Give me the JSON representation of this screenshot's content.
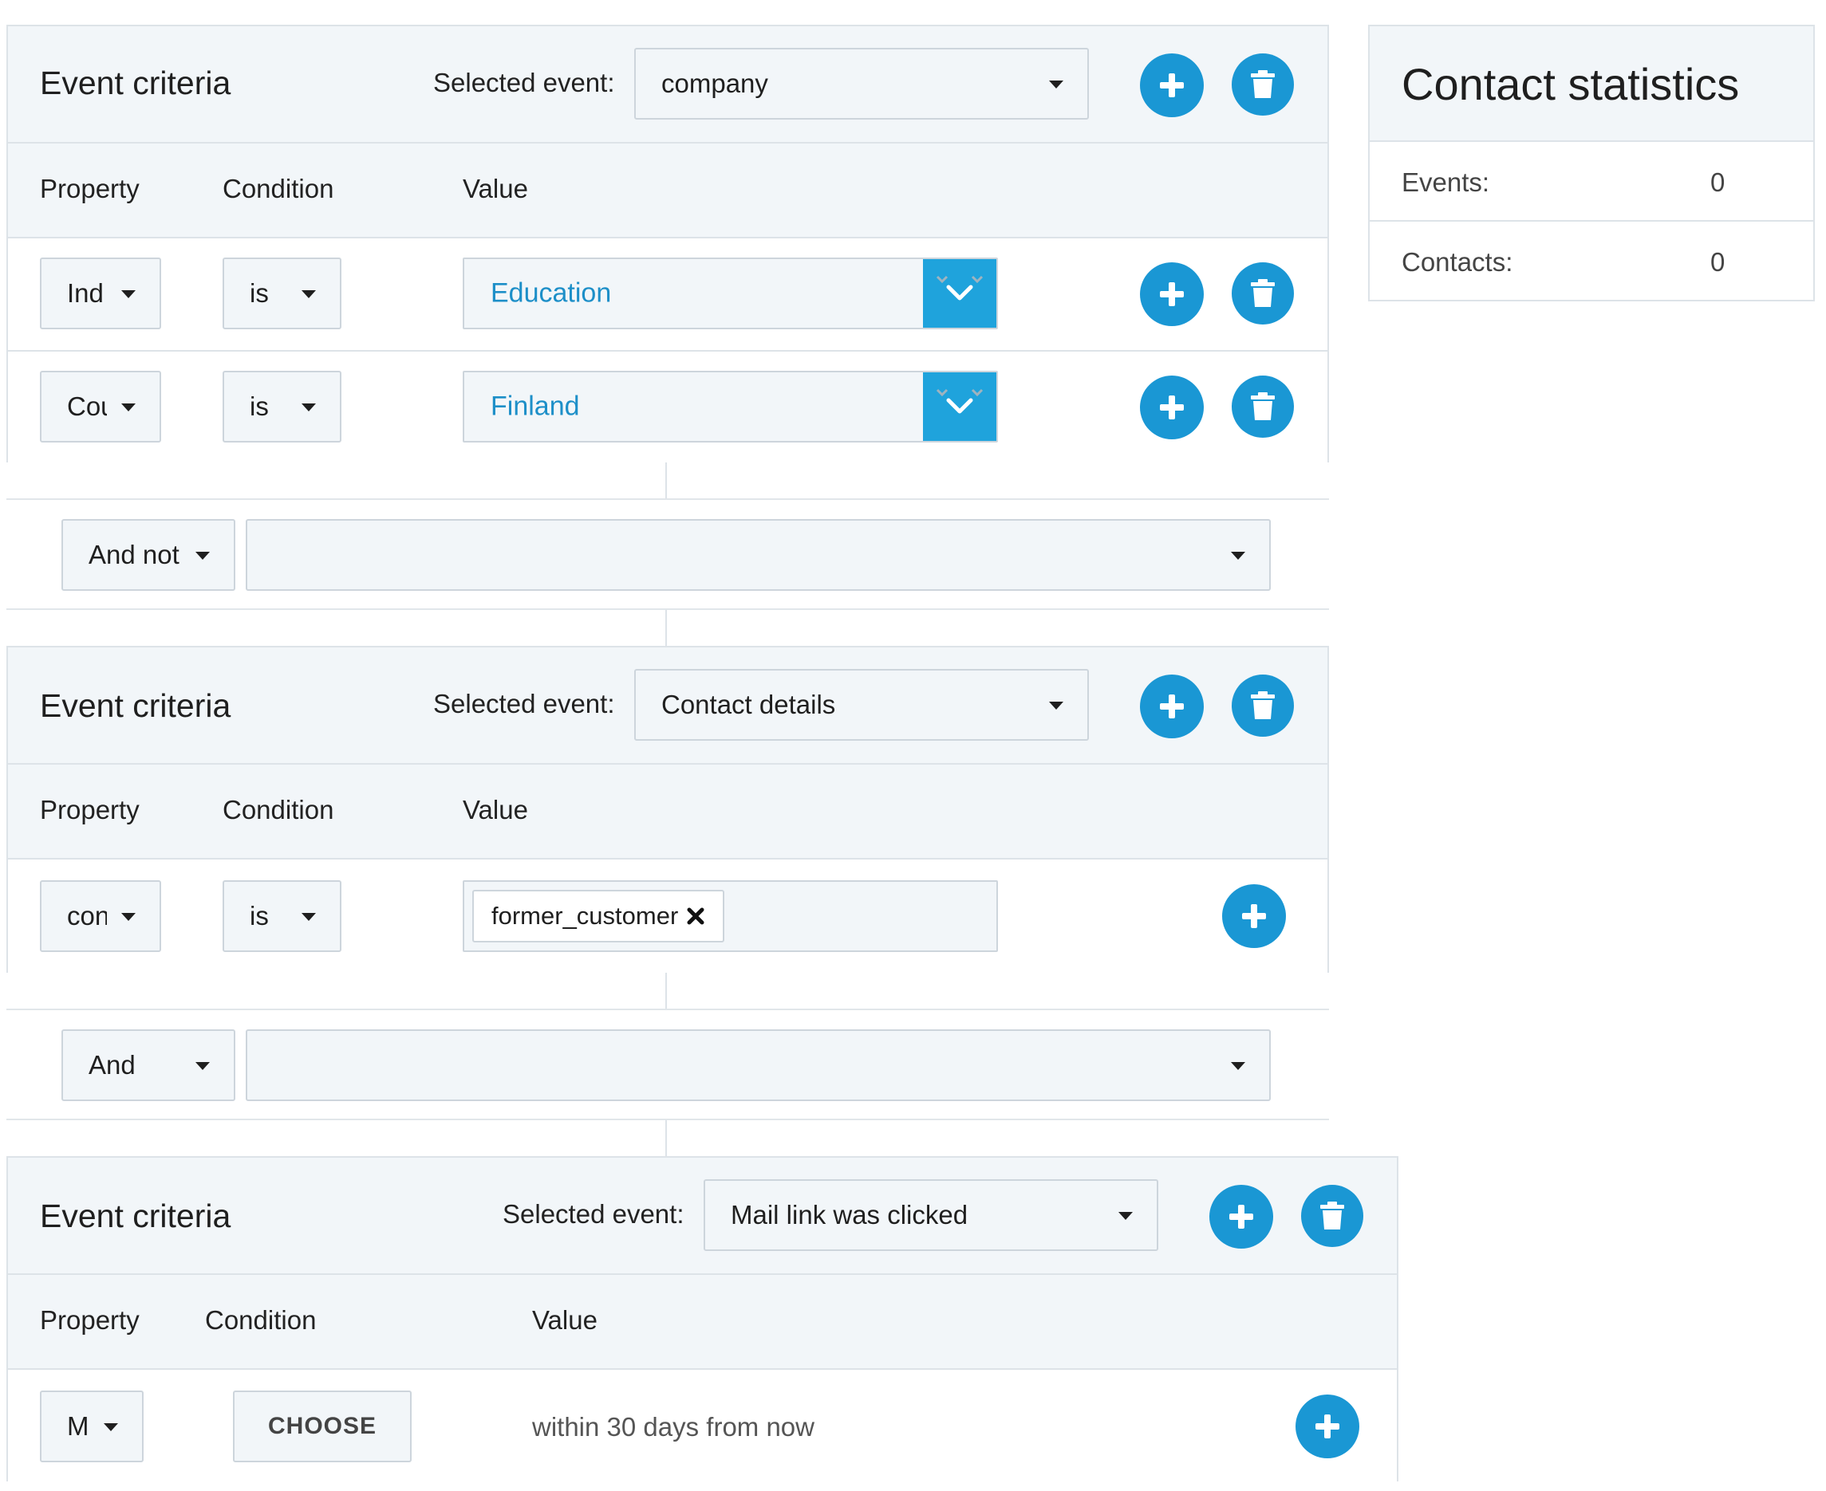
{
  "criteria_blocks": [
    {
      "title": "Event criteria",
      "selected_event_label": "Selected event:",
      "selected_event": "company",
      "headers": {
        "property": "Property",
        "condition": "Condition",
        "value": "Value"
      },
      "rows": [
        {
          "property": "Ind",
          "condition": "is",
          "value": "Education"
        },
        {
          "property": "Cou",
          "condition": "is",
          "value": "Finland"
        }
      ]
    },
    {
      "title": "Event criteria",
      "selected_event_label": "Selected event:",
      "selected_event": "Contact details",
      "headers": {
        "property": "Property",
        "condition": "Condition",
        "value": "Value"
      },
      "rows": [
        {
          "property": "con",
          "condition": "is",
          "value_tag": "former_customer"
        }
      ]
    },
    {
      "title": "Event criteria",
      "selected_event_label": "Selected event:",
      "selected_event": "Mail link was clicked",
      "headers": {
        "property": "Property",
        "condition": "Condition",
        "value": "Value"
      },
      "rows": [
        {
          "property": "M",
          "condition_button": "CHOOSE",
          "value_text": "within 30 days from now"
        }
      ]
    }
  ],
  "operators": [
    {
      "operator": "And not",
      "target": ""
    },
    {
      "operator": "And",
      "target": ""
    }
  ],
  "contact_statistics": {
    "title": "Contact statistics",
    "rows": [
      {
        "label": "Events:",
        "value": "0"
      },
      {
        "label": "Contacts:",
        "value": "0"
      }
    ]
  },
  "icons": {
    "add": "plus-icon",
    "delete": "trash-icon",
    "dropdown": "chevron-down-icon",
    "remove_tag": "close-icon"
  },
  "colors": {
    "accent": "#1a97d4",
    "panel_header_bg": "#f2f6f9",
    "border": "#dde3e8",
    "value_text": "#1d8fc8"
  }
}
